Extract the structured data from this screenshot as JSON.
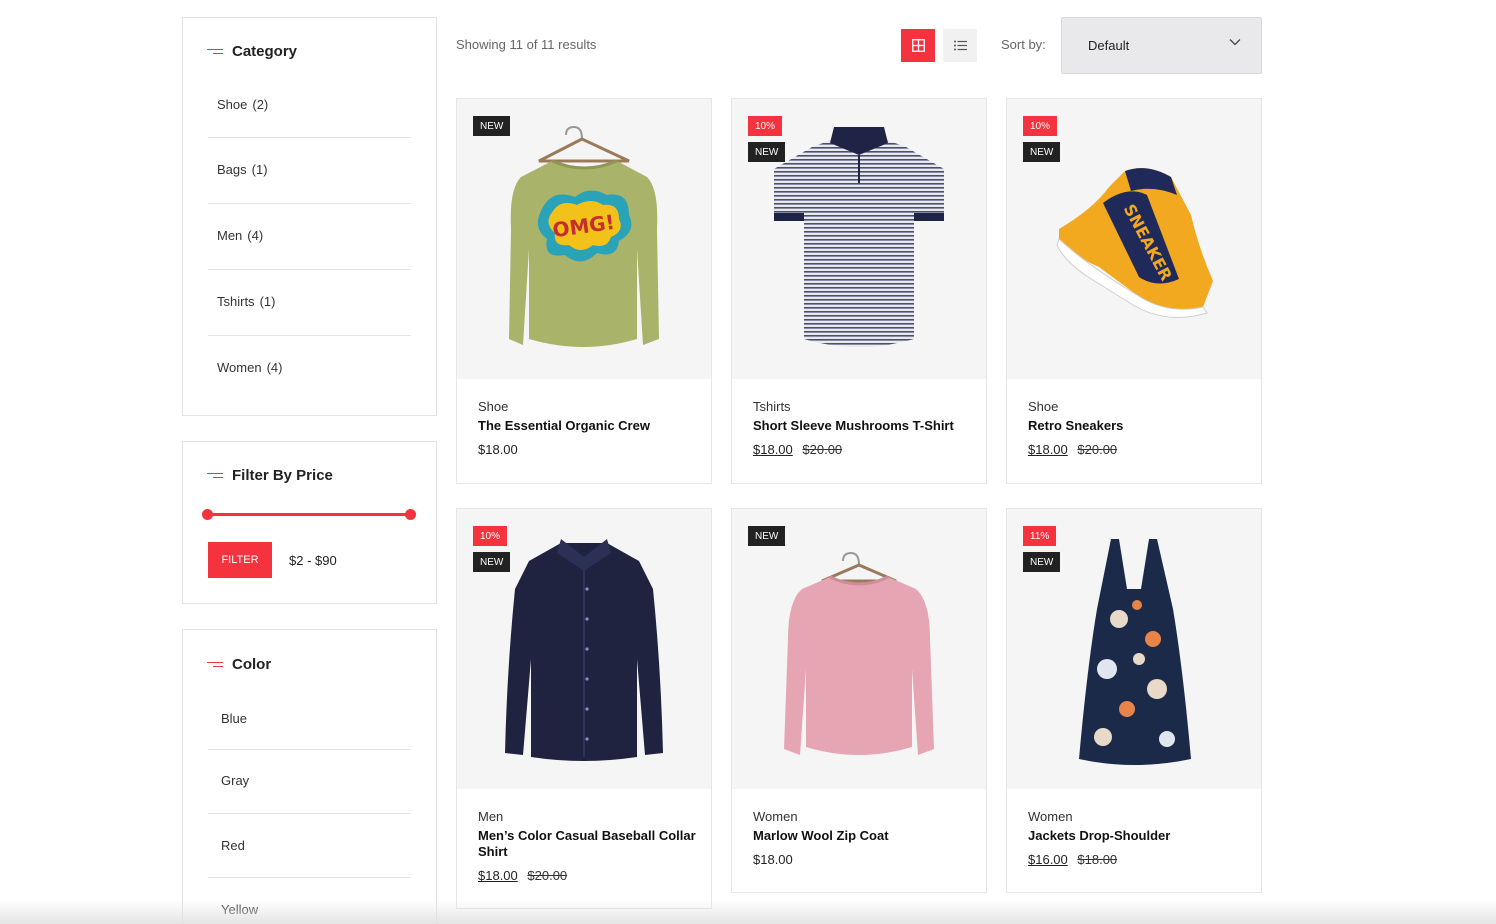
{
  "sidebar": {
    "category": {
      "title": "Category",
      "items": [
        {
          "label": "Shoe",
          "count": "(2)"
        },
        {
          "label": "Bags",
          "count": "(1)"
        },
        {
          "label": "Men",
          "count": "(4)"
        },
        {
          "label": "Tshirts",
          "count": "(1)"
        },
        {
          "label": "Women",
          "count": "(4)"
        }
      ]
    },
    "price": {
      "title": "Filter By Price",
      "button": "FILTER",
      "range": "$2 - $90",
      "min": 2,
      "max": 90
    },
    "color": {
      "title": "Color",
      "items": [
        "Blue",
        "Gray",
        "Red",
        "Yellow"
      ]
    }
  },
  "toolbar": {
    "results": "Showing 11 of 11 results",
    "sort_label": "Sort by:",
    "sort_value": "Default"
  },
  "accent_color": "#f5333f",
  "products": [
    {
      "category": "Shoe",
      "name": "The Essential Organic Crew",
      "price": "$18.00",
      "old_price": "",
      "badges": [
        "NEW"
      ],
      "image": "green-sweatshirt"
    },
    {
      "category": "Tshirts",
      "name": "Short Sleeve Mushrooms T-Shirt",
      "price": "$18.00",
      "old_price": "$20.00",
      "badges": [
        "10%",
        "NEW"
      ],
      "image": "striped-polo"
    },
    {
      "category": "Shoe",
      "name": "Retro Sneakers",
      "price": "$18.00",
      "old_price": "$20.00",
      "badges": [
        "10%",
        "NEW"
      ],
      "image": "sneaker"
    },
    {
      "category": "Men",
      "name": "Men’s Color Casual Baseball Collar Shirt",
      "price": "$18.00",
      "old_price": "$20.00",
      "badges": [
        "10%",
        "NEW"
      ],
      "image": "navy-shirt"
    },
    {
      "category": "Women",
      "name": "Marlow Wool Zip Coat",
      "price": "$18.00",
      "old_price": "",
      "badges": [
        "NEW"
      ],
      "image": "pink-sweatshirt"
    },
    {
      "category": "Women",
      "name": "Jackets Drop-Shoulder",
      "price": "$16.00",
      "old_price": "$18.00",
      "badges": [
        "11%",
        "NEW"
      ],
      "image": "floral-dress"
    }
  ]
}
